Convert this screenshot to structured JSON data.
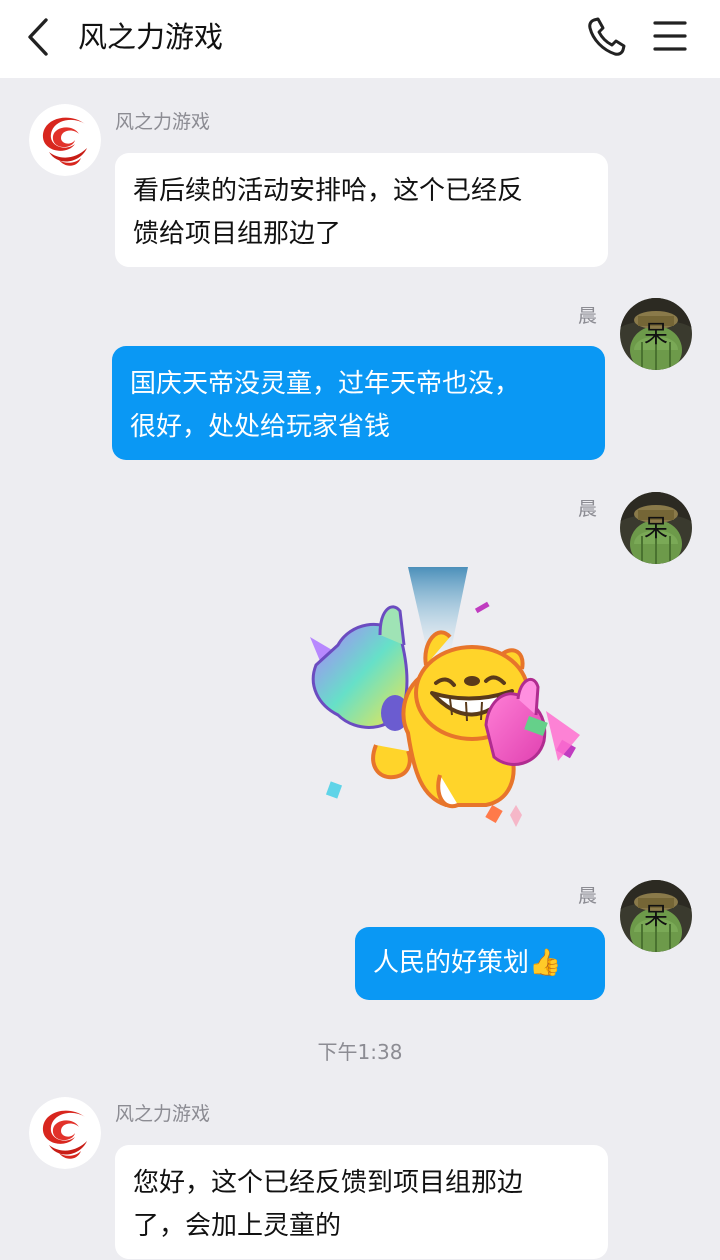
{
  "header": {
    "title": "风之力游戏",
    "back_icon": "chevron-left-icon",
    "call_icon": "phone-icon",
    "menu_icon": "hamburger-menu-icon"
  },
  "colors": {
    "outgoing_bubble": "#0a98f4",
    "incoming_bubble": "#ffffff",
    "background": "#ededf1",
    "name_text": "#8c8c93"
  },
  "messages": [
    {
      "direction": "incoming",
      "sender": "风之力游戏",
      "text": "看后续的活动安排哈，这个已经反\n馈给项目组那边了"
    },
    {
      "direction": "outgoing",
      "sender": "晨",
      "text": "国庆天帝没灵童，过年天帝也没，\n很好，处处给玩家省钱"
    },
    {
      "direction": "outgoing",
      "sender": "晨",
      "type": "sticker",
      "sticker_icon": "thumbs-up-cat-sticker"
    },
    {
      "direction": "outgoing",
      "sender": "晨",
      "text": "人民的好策划👍"
    },
    {
      "direction": "incoming",
      "sender": "风之力游戏",
      "text": "您好，这个已经反馈到项目组那边\n了，会加上灵童的"
    }
  ],
  "timestamp": "下午1:38",
  "avatars": {
    "self_badge": "呆"
  }
}
